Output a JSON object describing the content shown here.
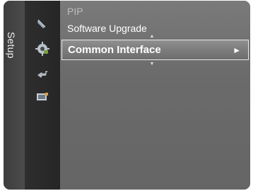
{
  "sidebar": {
    "label": "Setup"
  },
  "icons": [
    {
      "name": "picture-icon"
    },
    {
      "name": "setup-gear-icon"
    },
    {
      "name": "input-icon"
    },
    {
      "name": "support-icon"
    }
  ],
  "menu": {
    "items": [
      {
        "label": "PIP"
      },
      {
        "label": "Software Upgrade"
      },
      {
        "label": "Common Interface",
        "selected": true
      }
    ],
    "arrow": "►",
    "scroll_up": "▲",
    "scroll_down": "▼"
  },
  "colors": {
    "accent_border": "#e8e8e8",
    "panel_bg": "#6f6f6f",
    "icon_bg": "#262626"
  }
}
